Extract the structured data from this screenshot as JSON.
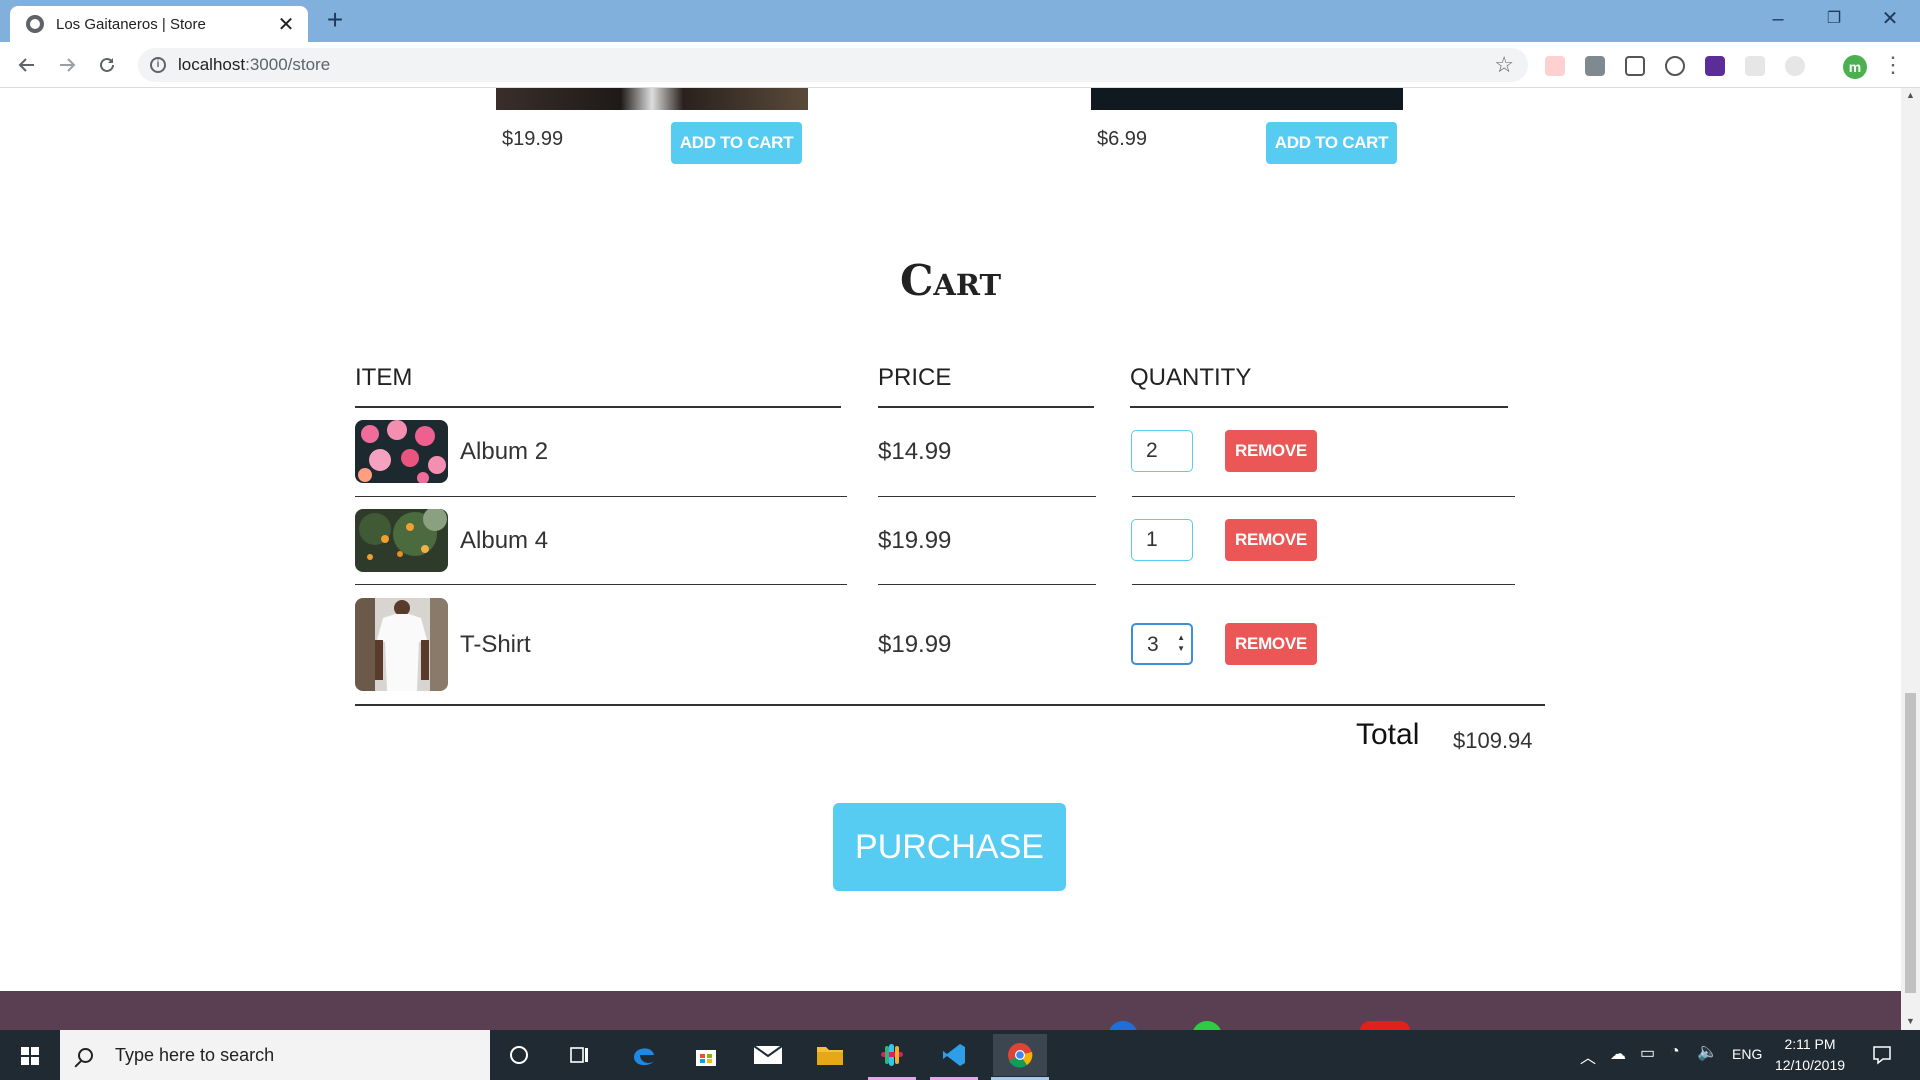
{
  "browser": {
    "tab_title": "Los Gaitaneros | Store",
    "tab_close": "✕",
    "new_tab": "+",
    "url_host": "localhost",
    "url_path": ":3000/store",
    "controls": {
      "minimize": "–",
      "restore": "❐",
      "close": "✕"
    },
    "profile_initial": "m",
    "extension_icons": [
      "red-arrow-extension-icon",
      "drive-icon",
      "screenshot-icon",
      "code-icon",
      "purple-check-icon",
      "grey-extension-icon",
      "grey-circle-extension-icon"
    ]
  },
  "store": {
    "products": [
      {
        "price": "$19.99",
        "button": "ADD TO CART"
      },
      {
        "price": "$6.99",
        "button": "ADD TO CART"
      }
    ]
  },
  "cart": {
    "title": "Cart",
    "headers": {
      "item": "ITEM",
      "price": "PRICE",
      "quantity": "QUANTITY"
    },
    "items": [
      {
        "name": "Album 2",
        "price": "$14.99",
        "quantity": "2",
        "remove": "REMOVE",
        "image": "pink-flowers"
      },
      {
        "name": "Album 4",
        "price": "$19.99",
        "quantity": "1",
        "remove": "REMOVE",
        "image": "orange-tree"
      },
      {
        "name": "T-Shirt",
        "price": "$19.99",
        "quantity": "3",
        "remove": "REMOVE",
        "image": "white-tshirt"
      }
    ],
    "total_label": "Total",
    "total_value": "$109.94",
    "purchase": "PURCHASE"
  },
  "taskbar": {
    "search_placeholder": "Type here to search",
    "language": "ENG",
    "time": "2:11 PM",
    "date": "12/10/2019"
  },
  "colors": {
    "accent": "#56ccf2",
    "remove": "#eb5757",
    "footer": "#5a3f52",
    "tabbar": "#82b0dc"
  }
}
